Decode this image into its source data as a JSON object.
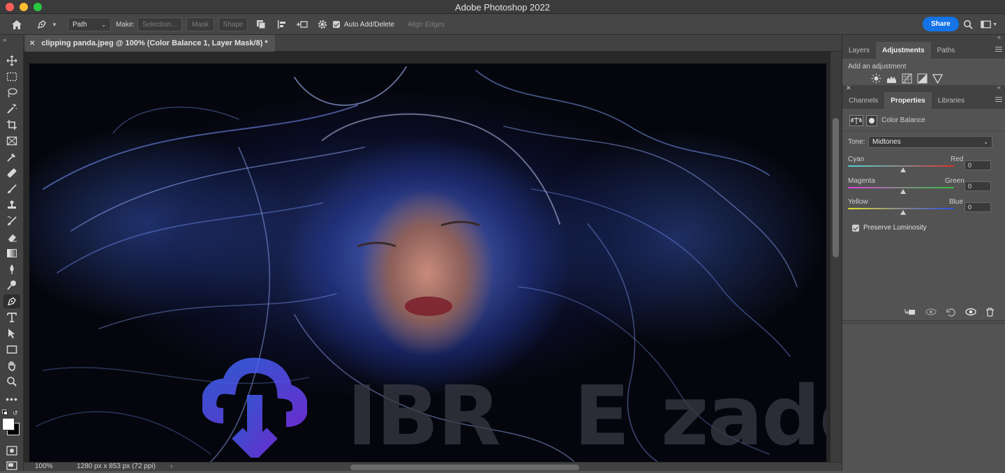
{
  "window": {
    "title": "Adobe Photoshop 2022"
  },
  "options_bar": {
    "mode_select": "Path",
    "make_label": "Make:",
    "selection_button": "Selection...",
    "mask_button": "Mask",
    "shape_button": "Shape",
    "auto_add_delete": "Auto Add/Delete",
    "align_edges": "Align Edges",
    "share_button": "Share"
  },
  "document": {
    "tab_title": "clipping panda.jpeg @ 100% (Color Balance 1, Layer Mask/8) *",
    "zoom": "100%",
    "info": "1280 px x 853 px (72 ppi)"
  },
  "panel_top": {
    "tabs": [
      "Layers",
      "Adjustments",
      "Paths"
    ],
    "active_tab": "Adjustments",
    "add_label": "Add an adjustment"
  },
  "panel_properties": {
    "tabs": [
      "Channels",
      "Properties",
      "Libraries"
    ],
    "active_tab": "Properties",
    "adjustment_name": "Color Balance",
    "tone_label": "Tone:",
    "tone_value": "Midtones",
    "sliders": [
      {
        "left": "Cyan",
        "right": "Red",
        "value": "0"
      },
      {
        "left": "Magenta",
        "right": "Green",
        "value": "0"
      },
      {
        "left": "Yellow",
        "right": "Blue",
        "value": "0"
      }
    ],
    "preserve_luminosity": "Preserve Luminosity"
  },
  "watermark": {
    "text_left": "IBR",
    "text_mid": "E",
    "text_right": "zado"
  }
}
